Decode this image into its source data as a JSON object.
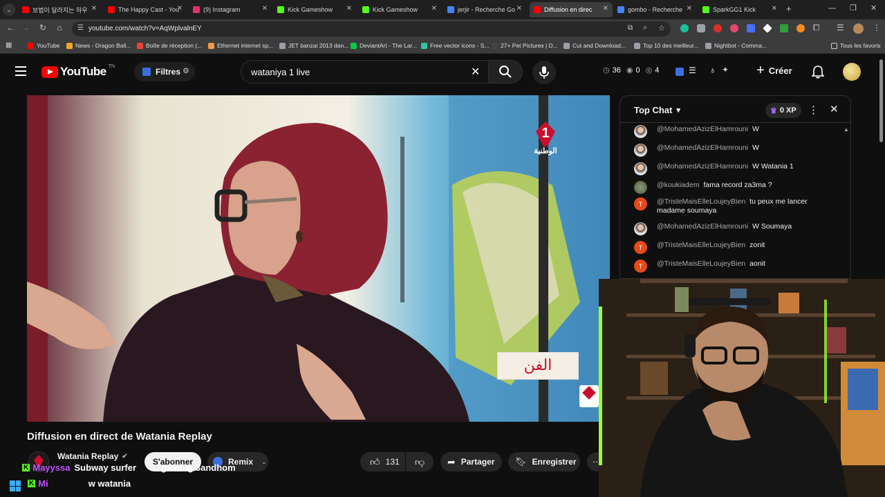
{
  "browser": {
    "tabs": [
      {
        "title": "보법이 달라지는 하우",
        "color": "#ff0000",
        "active": false
      },
      {
        "title": "The Happy Cast - You",
        "color": "#ff0000",
        "active": false
      },
      {
        "title": "(9) Instagram",
        "color": "#e1306c",
        "active": false
      },
      {
        "title": "Kick Gameshow",
        "color": "#53fc18",
        "active": false
      },
      {
        "title": "Kick Gameshow",
        "color": "#53fc18",
        "active": false
      },
      {
        "title": "jerjir - Recherche Go",
        "color": "#4285f4",
        "active": false
      },
      {
        "title": "Diffusion en direc",
        "color": "#ff0000",
        "active": true
      },
      {
        "title": "gombo - Recherche",
        "color": "#4285f4",
        "active": false
      },
      {
        "title": "SparkGG1 Kick",
        "color": "#53fc18",
        "active": false
      }
    ],
    "url": "youtube.com/watch?v=AqWplvalnEY",
    "bookmarks": [
      {
        "label": "YouTube",
        "color": "#ff0000"
      },
      {
        "label": "News - Dragon Ball...",
        "color": "#f5a623"
      },
      {
        "label": "Boîte de réception (...",
        "color": "#ea4335"
      },
      {
        "label": "Ethernet internet sp...",
        "color": "#f2994a"
      },
      {
        "label": "JET banzai 2013 dan...",
        "color": "#9aa0a6"
      },
      {
        "label": "DeviantArt - The Lar...",
        "color": "#05cc47"
      },
      {
        "label": "Free vector icons - S...",
        "color": "#30c4a4"
      },
      {
        "label": "27+ Pet Pictures | D...",
        "color": "#444444"
      },
      {
        "label": "Cut and Download...",
        "color": "#9aa0a6"
      },
      {
        "label": "Top 10 des meilleur...",
        "color": "#9aa0a6"
      },
      {
        "label": "Nightbot - Comma...",
        "color": "#9aa0a6"
      }
    ],
    "all_favorites": "Tous les favoris"
  },
  "yt": {
    "logo": "YouTube",
    "logo_sup": "TN",
    "filtres": "Filtres",
    "search_value": "wataniya 1 live",
    "stat_a": "36",
    "stat_b": "0",
    "stat_c": "4",
    "create": "Créer"
  },
  "video": {
    "title": "Diffusion en direct de Watania Replay",
    "channel": "Watania Replay",
    "subscribe": "S'abonner",
    "remix": "Remix",
    "likes": "131",
    "share": "Partager",
    "save": "Enregistrer",
    "channel_logo_text": "الوطنية",
    "watermark": "الفن"
  },
  "chat": {
    "header": "Top Chat",
    "xp": "0 XP",
    "messages": [
      {
        "author": "@MohamedAzizElHamrouni",
        "text": "W",
        "avatar": "photo"
      },
      {
        "author": "@MohamedAzizElHamrouni",
        "text": "W",
        "avatar": "photo"
      },
      {
        "author": "@MohamedAzizElHamrouni",
        "text": "W Watania 1",
        "avatar": "photo"
      },
      {
        "author": "@koukiadem",
        "text": "fama record za3ma ?",
        "avatar": "photo2"
      },
      {
        "author": "@TristeMaisElleLoujeyBien",
        "text": "tu peux me lancer madame soumaya",
        "avatar": "T"
      },
      {
        "author": "@MohamedAzizElHamrouni",
        "text": "W Soumaya",
        "avatar": "photo"
      },
      {
        "author": "@TristeMaisElleLoujeyBien",
        "text": "zonit",
        "avatar": "T"
      },
      {
        "author": "@TristeMaisElleLoujeyBien",
        "text": "aonit",
        "avatar": "T"
      }
    ]
  },
  "overlay": {
    "line1_user": "Mayyssa",
    "line1_text": "Subway surfer ",
    "line1_tail": "gaming 3andhom",
    "line2_user": "Mi",
    "line2_text": "w watania"
  },
  "colors": {
    "yt_red": "#ff0000",
    "chat_avatar_t": "#e64a19",
    "kick_green": "#53fc18"
  }
}
